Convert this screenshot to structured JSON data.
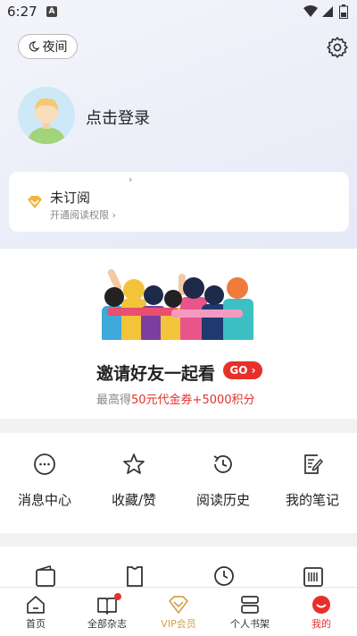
{
  "status_bar": {
    "time": "6:27",
    "notification_badge": "A"
  },
  "header": {
    "night_mode_label": "夜间",
    "settings_icon": "gear-icon"
  },
  "profile": {
    "login_text": "点击登录"
  },
  "subscription": {
    "small_arrow": "›",
    "title": "未订阅",
    "description": "开通阅读权限 ›",
    "icon": "crown-icon"
  },
  "invite": {
    "title": "邀请好友一起看",
    "go_label": "GO ›",
    "reward_prefix": "最高得",
    "reward_highlight": "50元代金券+5000积分"
  },
  "functions": [
    {
      "label": "消息中心",
      "icon": "message-icon"
    },
    {
      "label": "收藏/赞",
      "icon": "star-icon"
    },
    {
      "label": "阅读历史",
      "icon": "history-icon"
    },
    {
      "label": "我的笔记",
      "icon": "note-icon"
    }
  ],
  "tabs": [
    {
      "label": "首页",
      "icon": "home-icon"
    },
    {
      "label": "全部杂志",
      "icon": "magazine-icon"
    },
    {
      "label": "VIP会员",
      "icon": "vip-icon"
    },
    {
      "label": "个人书架",
      "icon": "bookshelf-icon"
    },
    {
      "label": "我的",
      "icon": "profile-icon"
    }
  ],
  "colors": {
    "accent_red": "#e8302a",
    "vip_gold": "#d4a24a",
    "active_tab": "#e8302a"
  }
}
